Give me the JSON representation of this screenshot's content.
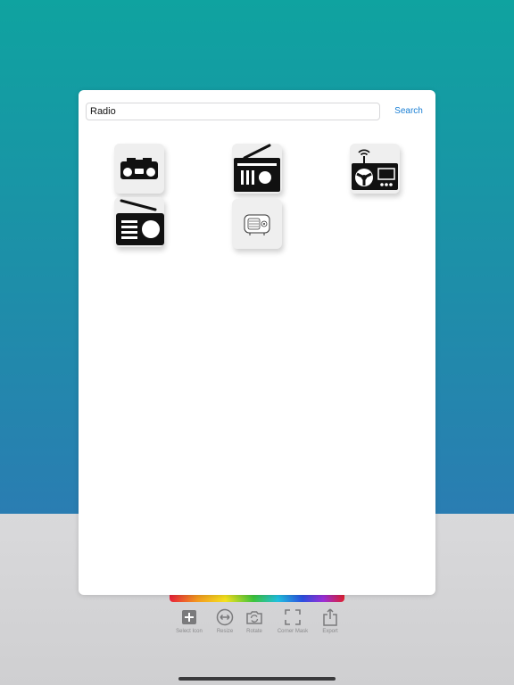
{
  "search": {
    "value": "Radio",
    "button_label": "Search"
  },
  "results": [
    {
      "icon": "boombox-icon"
    },
    {
      "icon": "portable-radio-icon"
    },
    {
      "icon": "car-radio-antenna-icon"
    },
    {
      "icon": "transistor-radio-icon"
    },
    {
      "icon": "vintage-radio-icon"
    }
  ],
  "toolbar": {
    "select_icon": "Select Icon",
    "resize": "Resize",
    "rotate": "Rotate",
    "corner_mask": "Corner Mask",
    "export": "Export"
  },
  "colors": {
    "background_top": "#0fa3a0",
    "background_bottom": "#2a7db2",
    "accent": "#1a7fd4",
    "icon": "#111111"
  }
}
